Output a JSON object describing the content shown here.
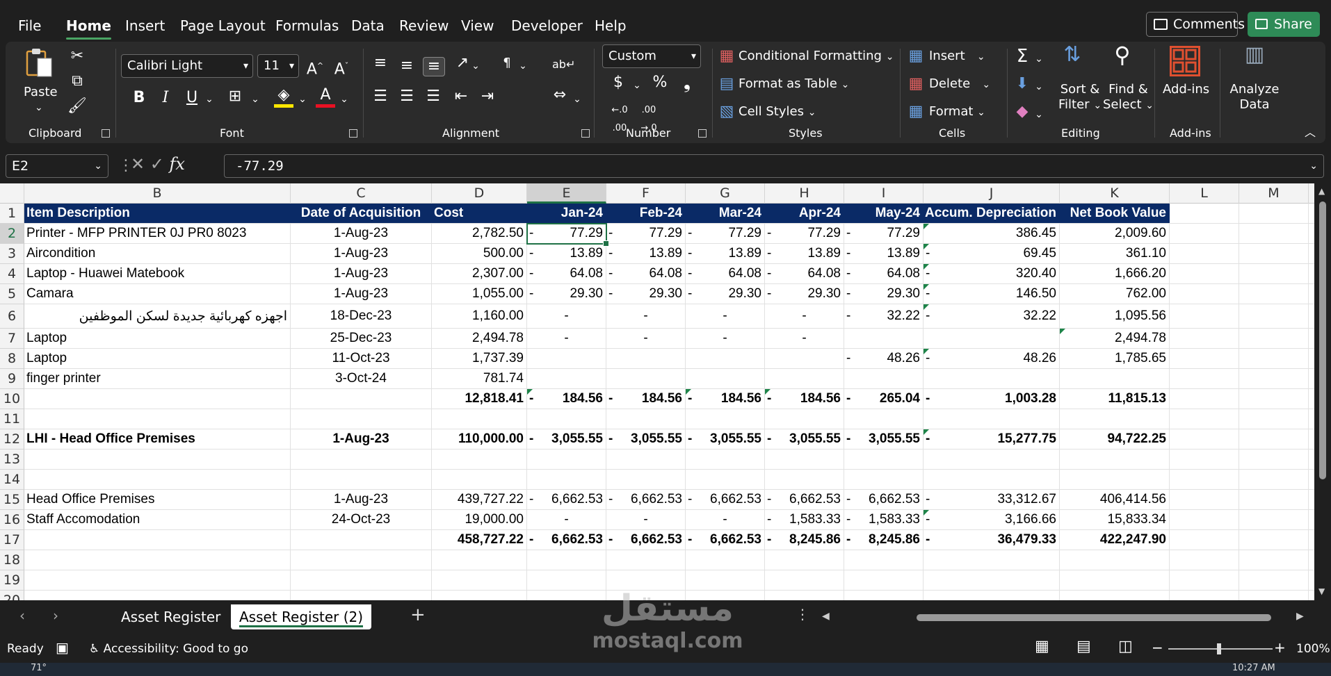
{
  "menu": {
    "items": [
      "File",
      "Home",
      "Insert",
      "Page Layout",
      "Formulas",
      "Data",
      "Review",
      "View",
      "Developer",
      "Help"
    ],
    "active": "Home",
    "comments": "Comments",
    "share": "Share"
  },
  "ribbon": {
    "clipboard": {
      "paste": "Paste",
      "label": "Clipboard"
    },
    "font": {
      "name": "Calibri Light",
      "size": "11",
      "label": "Font"
    },
    "alignment": {
      "label": "Alignment"
    },
    "number": {
      "format": "Custom",
      "label": "Number"
    },
    "styles": {
      "conditional": "Conditional Formatting",
      "table": "Format as Table",
      "cell": "Cell Styles",
      "label": "Styles"
    },
    "cells": {
      "insert": "Insert",
      "delete": "Delete",
      "format": "Format",
      "label": "Cells"
    },
    "editing": {
      "sort1": "Sort &",
      "sort2": "Filter",
      "find1": "Find &",
      "find2": "Select",
      "label": "Editing"
    },
    "addins": {
      "addins": "Add-ins",
      "analyze1": "Analyze",
      "analyze2": "Data",
      "label": "Add-ins"
    }
  },
  "formula": {
    "namebox": "E2",
    "value": "-77.29"
  },
  "columns": [
    "B",
    "C",
    "D",
    "E",
    "F",
    "G",
    "H",
    "I",
    "J",
    "K",
    "L",
    "M"
  ],
  "selected_column": "E",
  "rows": [
    {
      "n": "1",
      "header": true,
      "cells": [
        "Item Description",
        "Date of Acquisition",
        "Cost",
        "Jan-24",
        "Feb-24",
        "Mar-24",
        "Apr-24",
        "May-24",
        "Accum. Depreciation",
        "Net Book Value",
        "",
        ""
      ]
    },
    {
      "n": "2",
      "cells": [
        "Printer - MFP PRINTER 0J PR0 8023",
        "1-Aug-23",
        "2,782.50",
        "77.29",
        "77.29",
        "77.29",
        "77.29",
        "77.29",
        "386.45",
        "2,009.60",
        "",
        ""
      ],
      "dash": [
        3,
        4,
        5,
        6,
        7
      ],
      "tri": [
        8
      ]
    },
    {
      "n": "3",
      "cells": [
        "Aircondition",
        "1-Aug-23",
        "500.00",
        "13.89",
        "13.89",
        "13.89",
        "13.89",
        "13.89",
        "69.45",
        "361.10",
        "",
        ""
      ],
      "dash": [
        3,
        4,
        5,
        6,
        7,
        8
      ],
      "tri": [
        8
      ]
    },
    {
      "n": "4",
      "cells": [
        "Laptop - Huawei Matebook",
        "1-Aug-23",
        "2,307.00",
        "64.08",
        "64.08",
        "64.08",
        "64.08",
        "64.08",
        "320.40",
        "1,666.20",
        "",
        ""
      ],
      "dash": [
        3,
        4,
        5,
        6,
        7,
        8
      ],
      "tri": [
        8
      ]
    },
    {
      "n": "5",
      "cells": [
        "Camara",
        "1-Aug-23",
        "1,055.00",
        "29.30",
        "29.30",
        "29.30",
        "29.30",
        "29.30",
        "146.50",
        "762.00",
        "",
        ""
      ],
      "dash": [
        3,
        4,
        5,
        6,
        7,
        8
      ],
      "tri": [
        8
      ]
    },
    {
      "n": "6",
      "cells": [
        "اجهزه كهربائية جديدة لسكن الموظفين",
        "18-Dec-23",
        "1,160.00",
        "-",
        "-",
        "-",
        "-",
        "32.22",
        "32.22",
        "1,095.56",
        "",
        ""
      ],
      "dash": [
        7,
        8
      ],
      "tri": [
        8
      ],
      "arabic": true
    },
    {
      "n": "7",
      "cells": [
        "Laptop",
        "25-Dec-23",
        "2,494.78",
        "-",
        "-",
        "-",
        "-",
        "",
        "",
        "2,494.78",
        "",
        ""
      ],
      "tri": [
        9
      ]
    },
    {
      "n": "8",
      "cells": [
        "Laptop",
        "11-Oct-23",
        "1,737.39",
        "",
        "",
        "",
        "",
        "48.26",
        "48.26",
        "1,785.65",
        "",
        ""
      ],
      "dash": [
        7,
        8
      ],
      "tri": [
        8
      ]
    },
    {
      "n": "9",
      "cells": [
        "finger printer",
        "3-Oct-24",
        "781.74",
        "",
        "",
        "",
        "",
        "",
        "",
        "",
        "",
        ""
      ]
    },
    {
      "n": "10",
      "bold": true,
      "cells": [
        "",
        "",
        "12,818.41",
        "184.56",
        "184.56",
        "184.56",
        "184.56",
        "265.04",
        "1,003.28",
        "11,815.13",
        "",
        ""
      ],
      "dash": [
        3,
        4,
        5,
        6,
        7,
        8
      ],
      "tri": [
        3,
        5,
        6
      ]
    },
    {
      "n": "11",
      "cells": [
        "",
        "",
        "",
        "",
        "",
        "",
        "",
        "",
        "",
        "",
        "",
        ""
      ]
    },
    {
      "n": "12",
      "bold": true,
      "cells": [
        "LHI - Head Office Premises",
        "1-Aug-23",
        "110,000.00",
        "3,055.55",
        "3,055.55",
        "3,055.55",
        "3,055.55",
        "3,055.55",
        "15,277.75",
        "94,722.25",
        "",
        ""
      ],
      "dash": [
        3,
        4,
        5,
        6,
        7,
        8
      ],
      "tri": [
        8
      ]
    },
    {
      "n": "13",
      "cells": [
        "",
        "",
        "",
        "",
        "",
        "",
        "",
        "",
        "",
        "",
        "",
        ""
      ]
    },
    {
      "n": "14",
      "cells": [
        "",
        "",
        "",
        "",
        "",
        "",
        "",
        "",
        "",
        "",
        "",
        ""
      ]
    },
    {
      "n": "15",
      "cells": [
        "Head Office Premises",
        "1-Aug-23",
        "439,727.22",
        "6,662.53",
        "6,662.53",
        "6,662.53",
        "6,662.53",
        "6,662.53",
        "33,312.67",
        "406,414.56",
        "",
        ""
      ],
      "dash": [
        3,
        4,
        5,
        6,
        7,
        8
      ]
    },
    {
      "n": "16",
      "cells": [
        "Staff Accomodation",
        "24-Oct-23",
        "19,000.00",
        "-",
        "-",
        "-",
        "1,583.33",
        "1,583.33",
        "3,166.66",
        "15,833.34",
        "",
        ""
      ],
      "dash": [
        6,
        7,
        8
      ],
      "tri": [
        8
      ]
    },
    {
      "n": "17",
      "bold": true,
      "cells": [
        "",
        "",
        "458,727.22",
        "6,662.53",
        "6,662.53",
        "6,662.53",
        "8,245.86",
        "8,245.86",
        "36,479.33",
        "422,247.90",
        "",
        ""
      ],
      "dash": [
        3,
        4,
        5,
        6,
        7,
        8
      ]
    },
    {
      "n": "18",
      "cells": [
        "",
        "",
        "",
        "",
        "",
        "",
        "",
        "",
        "",
        "",
        "",
        ""
      ]
    },
    {
      "n": "19",
      "cells": [
        "",
        "",
        "",
        "",
        "",
        "",
        "",
        "",
        "",
        "",
        "",
        ""
      ]
    },
    {
      "n": "20",
      "cells": [
        "",
        "",
        "",
        "",
        "",
        "",
        "",
        "",
        "",
        "",
        "",
        ""
      ]
    }
  ],
  "tabs": [
    "Asset Register",
    "Asset Register (2)"
  ],
  "active_tab": "Asset Register (2)",
  "status": {
    "ready": "Ready",
    "accessibility": "Accessibility: Good to go",
    "zoom": "100%"
  },
  "watermark": {
    "arabic": "مستقل",
    "latin": "mostaql.com"
  },
  "taskbar": {
    "weather": "71°",
    "time": "10:27 AM"
  },
  "colors": {
    "header_bg": "#0a2a66",
    "accent": "#1e7145",
    "share": "#2e8b57"
  }
}
